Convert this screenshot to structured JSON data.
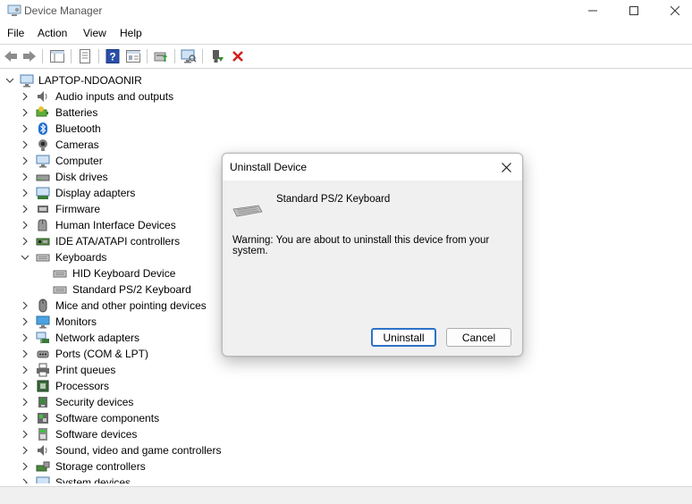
{
  "window": {
    "title": "Device Manager"
  },
  "menu": {
    "items": [
      "File",
      "Action",
      "View",
      "Help"
    ]
  },
  "tree": {
    "root": "LAPTOP-NDOAONIR",
    "categories": [
      {
        "label": "Audio inputs and outputs",
        "icon": "speaker-icon",
        "expanded": false
      },
      {
        "label": "Batteries",
        "icon": "battery-icon",
        "expanded": false
      },
      {
        "label": "Bluetooth",
        "icon": "bluetooth-icon",
        "expanded": false
      },
      {
        "label": "Cameras",
        "icon": "camera-icon",
        "expanded": false
      },
      {
        "label": "Computer",
        "icon": "computer-icon",
        "expanded": false
      },
      {
        "label": "Disk drives",
        "icon": "disk-drive-icon",
        "expanded": false
      },
      {
        "label": "Display adapters",
        "icon": "display-adapter-icon",
        "expanded": false
      },
      {
        "label": "Firmware",
        "icon": "firmware-icon",
        "expanded": false
      },
      {
        "label": "Human Interface Devices",
        "icon": "hid-icon",
        "expanded": false
      },
      {
        "label": "IDE ATA/ATAPI controllers",
        "icon": "ide-controller-icon",
        "expanded": false
      },
      {
        "label": "Keyboards",
        "icon": "keyboard-icon",
        "expanded": true,
        "children": [
          "HID Keyboard Device",
          "Standard PS/2 Keyboard"
        ]
      },
      {
        "label": "Mice and other pointing devices",
        "icon": "mouse-icon",
        "expanded": false
      },
      {
        "label": "Monitors",
        "icon": "monitor-icon",
        "expanded": false
      },
      {
        "label": "Network adapters",
        "icon": "network-adapter-icon",
        "expanded": false
      },
      {
        "label": "Ports (COM & LPT)",
        "icon": "port-icon",
        "expanded": false
      },
      {
        "label": "Print queues",
        "icon": "printer-icon",
        "expanded": false
      },
      {
        "label": "Processors",
        "icon": "processor-icon",
        "expanded": false
      },
      {
        "label": "Security devices",
        "icon": "security-device-icon",
        "expanded": false
      },
      {
        "label": "Software components",
        "icon": "software-component-icon",
        "expanded": false
      },
      {
        "label": "Software devices",
        "icon": "software-device-icon",
        "expanded": false
      },
      {
        "label": "Sound, video and game controllers",
        "icon": "sound-controller-icon",
        "expanded": false
      },
      {
        "label": "Storage controllers",
        "icon": "storage-controller-icon",
        "expanded": false
      },
      {
        "label": "System devices",
        "icon": "system-device-icon",
        "expanded": false
      }
    ]
  },
  "dialog": {
    "title": "Uninstall Device",
    "device_name": "Standard PS/2 Keyboard",
    "warning": "Warning: You are about to uninstall this device from your system.",
    "uninstall_label": "Uninstall",
    "cancel_label": "Cancel"
  },
  "colors": {
    "accent": "#2d72c9",
    "uninstall_x": "#d42020",
    "help_blue": "#2a4fa8"
  }
}
